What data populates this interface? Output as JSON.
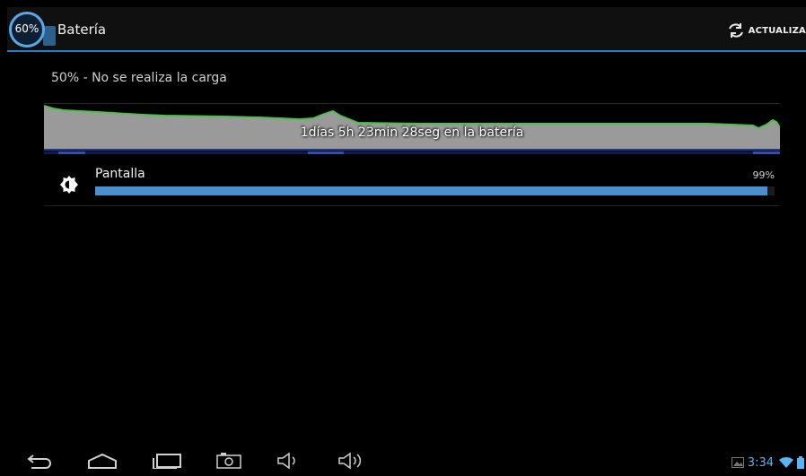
{
  "action_bar": {
    "icon_percent": "60%",
    "title": "Batería",
    "refresh_label": "ACTUALIZA"
  },
  "battery": {
    "status": "50% - No se realiza la carga",
    "duration_label": "1días 5h 23min 28seg en la batería"
  },
  "usage": [
    {
      "label": "Pantalla",
      "percent_text": "99%",
      "percent": 99
    }
  ],
  "status_bar": {
    "time": "3:34"
  },
  "colors": {
    "accent": "#33b5e5",
    "bar": "#4a8fd0",
    "graph_line": "#4cc14c",
    "graph_fill": "#9a9a9a"
  }
}
